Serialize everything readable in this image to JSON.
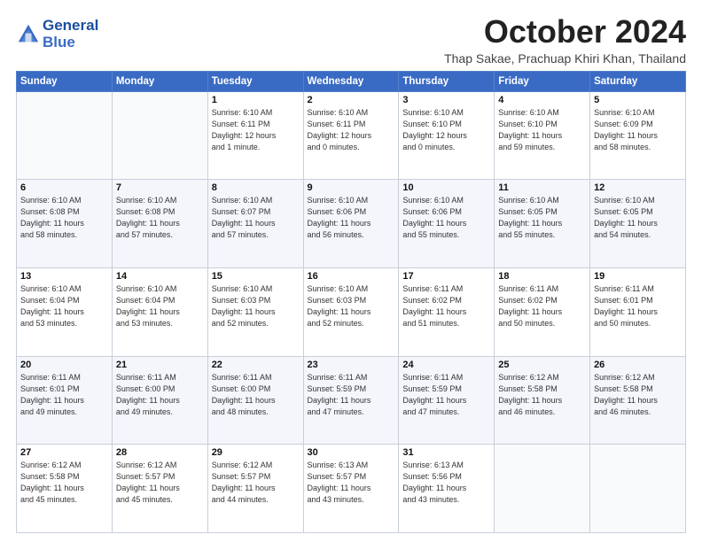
{
  "header": {
    "logo_line1": "General",
    "logo_line2": "Blue",
    "month_title": "October 2024",
    "subtitle": "Thap Sakae, Prachuap Khiri Khan, Thailand"
  },
  "days_of_week": [
    "Sunday",
    "Monday",
    "Tuesday",
    "Wednesday",
    "Thursday",
    "Friday",
    "Saturday"
  ],
  "weeks": [
    [
      {
        "day": "",
        "info": ""
      },
      {
        "day": "",
        "info": ""
      },
      {
        "day": "1",
        "info": "Sunrise: 6:10 AM\nSunset: 6:11 PM\nDaylight: 12 hours\nand 1 minute."
      },
      {
        "day": "2",
        "info": "Sunrise: 6:10 AM\nSunset: 6:11 PM\nDaylight: 12 hours\nand 0 minutes."
      },
      {
        "day": "3",
        "info": "Sunrise: 6:10 AM\nSunset: 6:10 PM\nDaylight: 12 hours\nand 0 minutes."
      },
      {
        "day": "4",
        "info": "Sunrise: 6:10 AM\nSunset: 6:10 PM\nDaylight: 11 hours\nand 59 minutes."
      },
      {
        "day": "5",
        "info": "Sunrise: 6:10 AM\nSunset: 6:09 PM\nDaylight: 11 hours\nand 58 minutes."
      }
    ],
    [
      {
        "day": "6",
        "info": "Sunrise: 6:10 AM\nSunset: 6:08 PM\nDaylight: 11 hours\nand 58 minutes."
      },
      {
        "day": "7",
        "info": "Sunrise: 6:10 AM\nSunset: 6:08 PM\nDaylight: 11 hours\nand 57 minutes."
      },
      {
        "day": "8",
        "info": "Sunrise: 6:10 AM\nSunset: 6:07 PM\nDaylight: 11 hours\nand 57 minutes."
      },
      {
        "day": "9",
        "info": "Sunrise: 6:10 AM\nSunset: 6:06 PM\nDaylight: 11 hours\nand 56 minutes."
      },
      {
        "day": "10",
        "info": "Sunrise: 6:10 AM\nSunset: 6:06 PM\nDaylight: 11 hours\nand 55 minutes."
      },
      {
        "day": "11",
        "info": "Sunrise: 6:10 AM\nSunset: 6:05 PM\nDaylight: 11 hours\nand 55 minutes."
      },
      {
        "day": "12",
        "info": "Sunrise: 6:10 AM\nSunset: 6:05 PM\nDaylight: 11 hours\nand 54 minutes."
      }
    ],
    [
      {
        "day": "13",
        "info": "Sunrise: 6:10 AM\nSunset: 6:04 PM\nDaylight: 11 hours\nand 53 minutes."
      },
      {
        "day": "14",
        "info": "Sunrise: 6:10 AM\nSunset: 6:04 PM\nDaylight: 11 hours\nand 53 minutes."
      },
      {
        "day": "15",
        "info": "Sunrise: 6:10 AM\nSunset: 6:03 PM\nDaylight: 11 hours\nand 52 minutes."
      },
      {
        "day": "16",
        "info": "Sunrise: 6:10 AM\nSunset: 6:03 PM\nDaylight: 11 hours\nand 52 minutes."
      },
      {
        "day": "17",
        "info": "Sunrise: 6:11 AM\nSunset: 6:02 PM\nDaylight: 11 hours\nand 51 minutes."
      },
      {
        "day": "18",
        "info": "Sunrise: 6:11 AM\nSunset: 6:02 PM\nDaylight: 11 hours\nand 50 minutes."
      },
      {
        "day": "19",
        "info": "Sunrise: 6:11 AM\nSunset: 6:01 PM\nDaylight: 11 hours\nand 50 minutes."
      }
    ],
    [
      {
        "day": "20",
        "info": "Sunrise: 6:11 AM\nSunset: 6:01 PM\nDaylight: 11 hours\nand 49 minutes."
      },
      {
        "day": "21",
        "info": "Sunrise: 6:11 AM\nSunset: 6:00 PM\nDaylight: 11 hours\nand 49 minutes."
      },
      {
        "day": "22",
        "info": "Sunrise: 6:11 AM\nSunset: 6:00 PM\nDaylight: 11 hours\nand 48 minutes."
      },
      {
        "day": "23",
        "info": "Sunrise: 6:11 AM\nSunset: 5:59 PM\nDaylight: 11 hours\nand 47 minutes."
      },
      {
        "day": "24",
        "info": "Sunrise: 6:11 AM\nSunset: 5:59 PM\nDaylight: 11 hours\nand 47 minutes."
      },
      {
        "day": "25",
        "info": "Sunrise: 6:12 AM\nSunset: 5:58 PM\nDaylight: 11 hours\nand 46 minutes."
      },
      {
        "day": "26",
        "info": "Sunrise: 6:12 AM\nSunset: 5:58 PM\nDaylight: 11 hours\nand 46 minutes."
      }
    ],
    [
      {
        "day": "27",
        "info": "Sunrise: 6:12 AM\nSunset: 5:58 PM\nDaylight: 11 hours\nand 45 minutes."
      },
      {
        "day": "28",
        "info": "Sunrise: 6:12 AM\nSunset: 5:57 PM\nDaylight: 11 hours\nand 45 minutes."
      },
      {
        "day": "29",
        "info": "Sunrise: 6:12 AM\nSunset: 5:57 PM\nDaylight: 11 hours\nand 44 minutes."
      },
      {
        "day": "30",
        "info": "Sunrise: 6:13 AM\nSunset: 5:57 PM\nDaylight: 11 hours\nand 43 minutes."
      },
      {
        "day": "31",
        "info": "Sunrise: 6:13 AM\nSunset: 5:56 PM\nDaylight: 11 hours\nand 43 minutes."
      },
      {
        "day": "",
        "info": ""
      },
      {
        "day": "",
        "info": ""
      }
    ]
  ]
}
